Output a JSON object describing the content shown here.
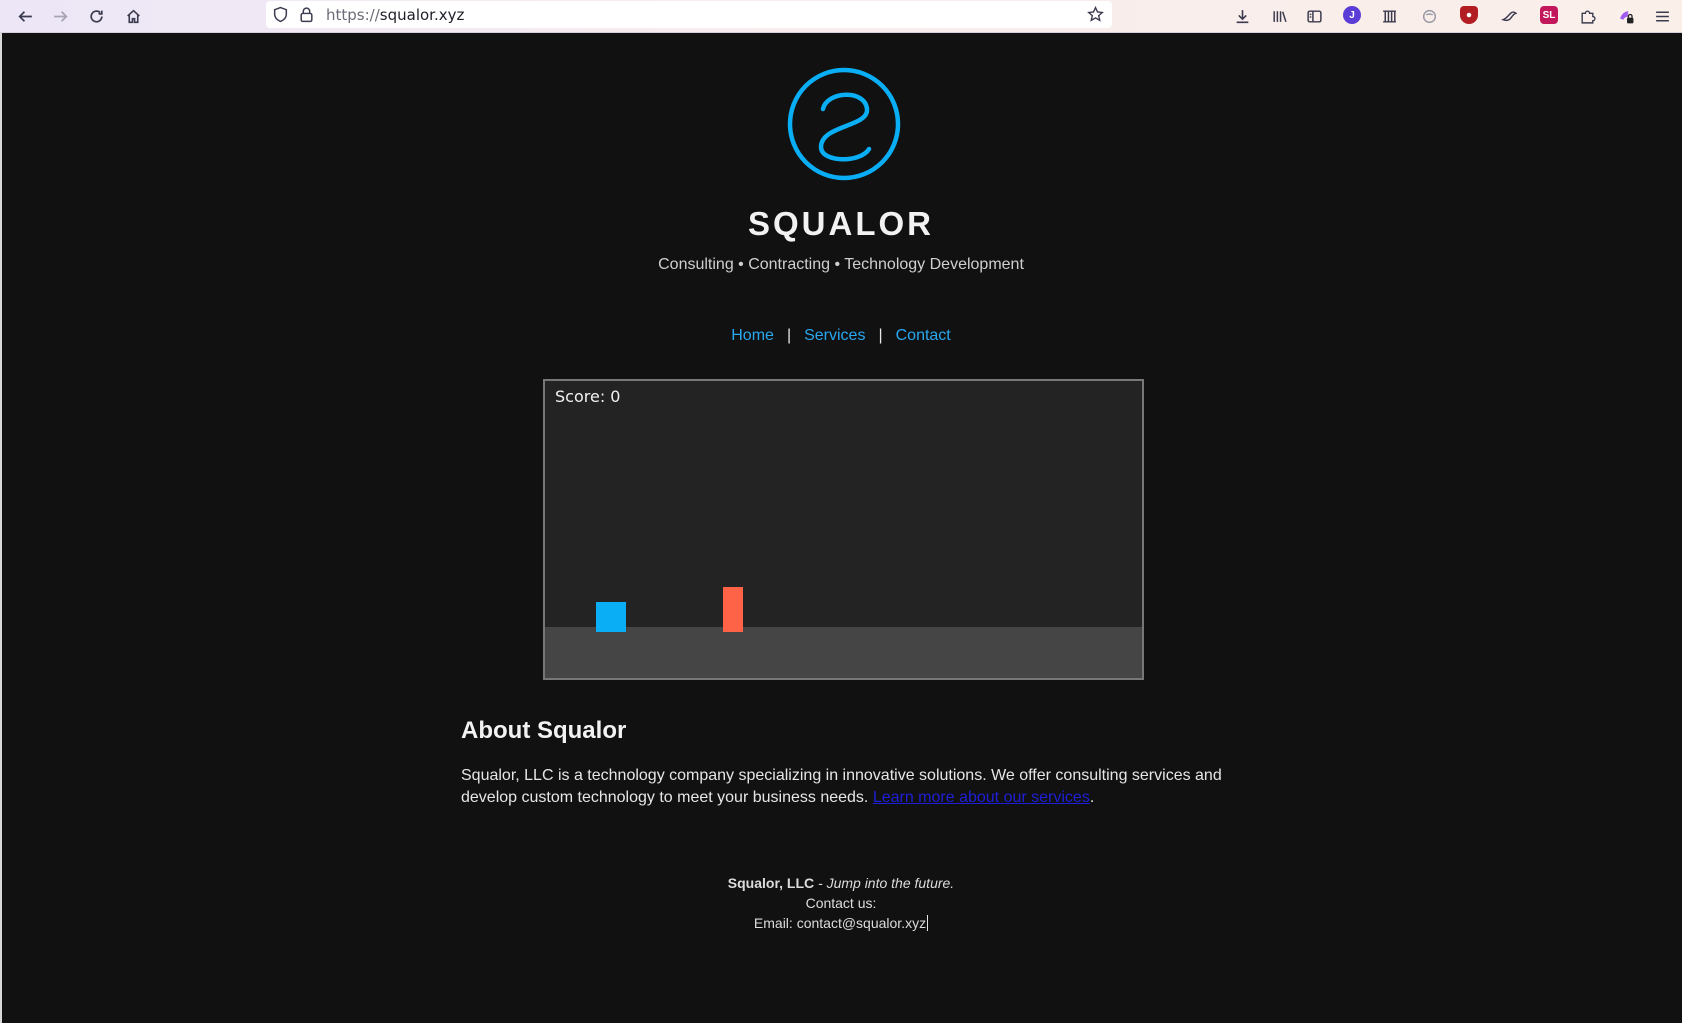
{
  "browser": {
    "url_scheme": "https://",
    "url_host": "squalor.xyz",
    "extension_labels": [
      "J",
      "SL"
    ]
  },
  "site": {
    "brand": "SQUALOR",
    "tagline": "Consulting • Contracting • Technology Development",
    "accent_color": "#29a8f0",
    "nav": [
      {
        "label": "Home"
      },
      {
        "label": "Services"
      },
      {
        "label": "Contact"
      }
    ],
    "nav_separator": "|"
  },
  "game": {
    "score_label": "Score: 0",
    "player_color": "#0aaef5",
    "obstacle_color": "#ff6347"
  },
  "about": {
    "heading": "About Squalor",
    "text": "Squalor, LLC is a technology company specializing in innovative solutions. We offer consulting services and develop custom technology to meet your business needs.",
    "link": "Learn more about our services",
    "link_suffix": "."
  },
  "footer": {
    "company": "Squalor, LLC",
    "motto": "- Jump into the future.",
    "contact_label": "Contact us:",
    "email_line": "Email: contact@squalor.xyz"
  }
}
